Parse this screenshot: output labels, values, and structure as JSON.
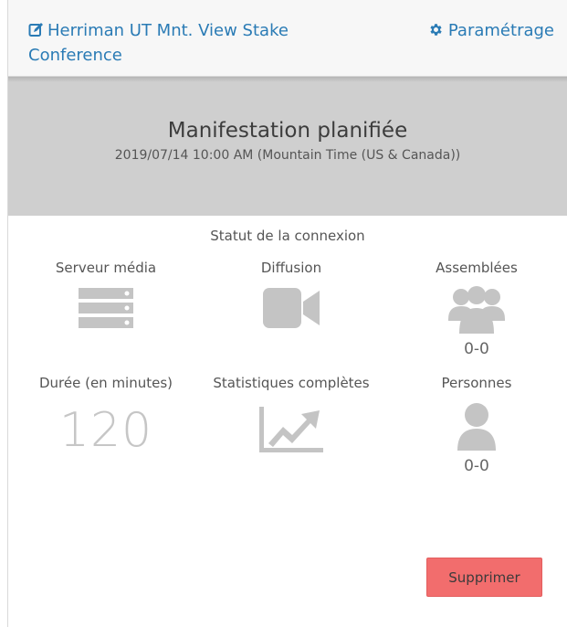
{
  "header": {
    "event_title_line1": "Herriman UT Mnt. View Stake",
    "event_title_line2": "Conference",
    "settings_label": "Paramétrage",
    "link_color": "#2a7bb5"
  },
  "banner": {
    "title": "Manifestation planifiée",
    "datetime": "2019/07/14 10:00 AM (Mountain Time (US & Canada))"
  },
  "status": {
    "section_title": "Statut de la connexion",
    "media_server": {
      "label": "Serveur média",
      "icon": "server-icon"
    },
    "broadcast": {
      "label": "Diffusion",
      "icon": "video-camera-icon"
    },
    "assemblies": {
      "label": "Assemblées",
      "icon": "users-group-icon",
      "value": "0-0"
    },
    "duration": {
      "label": "Durée (en minutes)",
      "value": "120"
    },
    "full_stats": {
      "label": "Statistiques complètes",
      "icon": "line-chart-icon"
    },
    "persons": {
      "label": "Personnes",
      "icon": "user-icon",
      "value": "0-0"
    }
  },
  "actions": {
    "delete_label": "Supprimer",
    "delete_color": "#f26d6d"
  }
}
